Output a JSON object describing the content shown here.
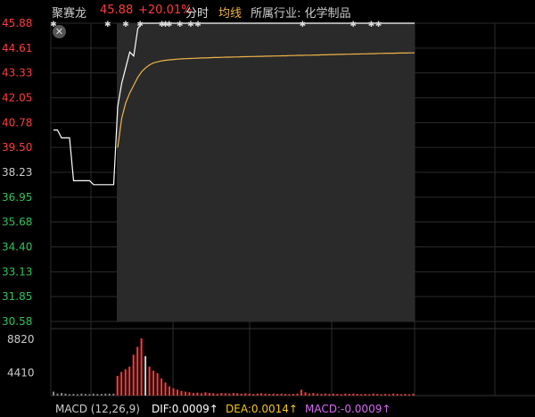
{
  "header": {
    "stock_name": "聚赛龙",
    "price": "45.88",
    "change_pct": "+20.01%",
    "tab_minute": "分时",
    "tab_avg": "均线",
    "industry_label": "所属行业: 化学制品"
  },
  "close_icon": "close-icon",
  "colors": {
    "price_line": "#ffffff",
    "avg_line": "#f0b44a",
    "up": "#ff3b3b",
    "down": "#2fc25b",
    "dif": "#ffffff",
    "dea": "#f5c518",
    "macd": "#d36bf0"
  },
  "chart_data": {
    "type": "line",
    "price_axis": {
      "ticks": [
        "45.88",
        "44.61",
        "43.33",
        "42.05",
        "40.78",
        "39.50",
        "38.23",
        "36.95",
        "35.68",
        "34.40",
        "33.13",
        "31.85",
        "30.58"
      ],
      "ylim": [
        30.58,
        45.88
      ],
      "prev_close": 38.23
    },
    "series": [
      {
        "values": [
          40.4,
          40.4,
          40.0,
          40.0,
          40.0,
          37.8,
          37.8,
          37.8,
          37.8,
          37.8,
          37.6,
          37.6,
          37.6,
          37.6,
          37.6,
          37.6,
          41.6,
          42.8,
          43.6,
          44.4,
          44.2,
          45.6,
          45.88,
          45.88,
          45.88,
          45.88,
          45.88,
          45.88,
          45.88,
          45.88,
          45.88,
          45.88,
          45.88,
          45.88,
          45.88,
          45.88,
          45.88,
          45.88,
          45.88,
          45.88,
          45.88,
          45.88,
          45.88,
          45.88,
          45.88,
          45.88,
          45.88,
          45.88,
          45.88,
          45.88,
          45.88,
          45.88,
          45.88,
          45.88,
          45.88,
          45.88,
          45.88,
          45.88,
          45.88,
          45.88,
          45.88,
          45.88,
          45.88,
          45.88,
          45.88,
          45.88,
          45.88,
          45.88,
          45.88,
          45.88,
          45.88,
          45.88,
          45.88,
          45.88,
          45.88,
          45.88,
          45.88,
          45.88,
          45.88,
          45.88,
          45.88,
          45.88,
          45.88,
          45.88,
          45.88,
          45.88,
          45.88,
          45.88,
          45.88,
          45.88,
          45.88
        ]
      },
      {
        "values": [
          null,
          null,
          null,
          null,
          null,
          null,
          null,
          null,
          null,
          null,
          null,
          null,
          null,
          null,
          null,
          null,
          39.5,
          41.0,
          41.8,
          42.3,
          42.7,
          43.1,
          43.4,
          43.6,
          43.75,
          43.85,
          43.9,
          43.95,
          43.98,
          44.0,
          44.02,
          44.04,
          44.05,
          44.06,
          44.07,
          44.08,
          44.09,
          44.1,
          44.1,
          44.11,
          44.12,
          44.12,
          44.13,
          44.14,
          44.14,
          44.15,
          44.15,
          44.16,
          44.16,
          44.17,
          44.17,
          44.18,
          44.18,
          44.19,
          44.19,
          44.2,
          44.2,
          44.21,
          44.21,
          44.22,
          44.22,
          44.23,
          44.23,
          44.24,
          44.24,
          44.25,
          44.25,
          44.26,
          44.26,
          44.27,
          44.27,
          44.28,
          44.28,
          44.29,
          44.29,
          44.3,
          44.3,
          44.31,
          44.31,
          44.32,
          44.32,
          44.33,
          44.33,
          44.34,
          44.34,
          44.34,
          44.35,
          44.35,
          44.35,
          44.36,
          44.36
        ]
      }
    ],
    "volume": {
      "ticks": [
        "8820",
        "4410"
      ],
      "ylim": [
        0,
        8820
      ],
      "values": [
        600,
        300,
        400,
        300,
        200,
        250,
        200,
        300,
        250,
        200,
        300,
        250,
        250,
        300,
        300,
        300,
        3000,
        3600,
        4000,
        4400,
        6200,
        7400,
        8700,
        6000,
        4400,
        3800,
        3400,
        2600,
        2000,
        1400,
        1100,
        900,
        700,
        600,
        500,
        400,
        450,
        350,
        500,
        400,
        350,
        300,
        400,
        350,
        300,
        400,
        350,
        300,
        350,
        300,
        250,
        300,
        350,
        300,
        250,
        300,
        250,
        300,
        250,
        200,
        250,
        300,
        900,
        500,
        300,
        400,
        300,
        250,
        300,
        250,
        300,
        250,
        200,
        300,
        250,
        300,
        250,
        200,
        250,
        200,
        300,
        250,
        200,
        250,
        200,
        300,
        250,
        200,
        250,
        200,
        300
      ],
      "colors": [
        "d",
        "d",
        "d",
        "d",
        "d",
        "d",
        "d",
        "d",
        "d",
        "d",
        "d",
        "d",
        "d",
        "d",
        "d",
        "d",
        "u",
        "u",
        "u",
        "u",
        "u",
        "u",
        "u",
        "w",
        "u",
        "u",
        "u",
        "u",
        "u",
        "u",
        "u",
        "u",
        "u",
        "u",
        "u",
        "u",
        "u",
        "u",
        "u",
        "u",
        "u",
        "u",
        "u",
        "u",
        "u",
        "u",
        "u",
        "u",
        "u",
        "u",
        "u",
        "u",
        "u",
        "u",
        "u",
        "u",
        "u",
        "u",
        "u",
        "u",
        "u",
        "u",
        "u",
        "u",
        "u",
        "u",
        "u",
        "u",
        "u",
        "u",
        "u",
        "u",
        "u",
        "u",
        "u",
        "u",
        "u",
        "u",
        "u",
        "u",
        "u",
        "u",
        "u",
        "u",
        "u",
        "u",
        "u",
        "u",
        "u",
        "u",
        "u"
      ]
    },
    "markers_count": 14,
    "grid": true
  },
  "macd": {
    "label": "MACD (12,26,9)",
    "dif": "DIF:0.0009",
    "dea": "DEA:0.0014",
    "macd": "MACD:-0.0009",
    "arrow": "↑"
  }
}
